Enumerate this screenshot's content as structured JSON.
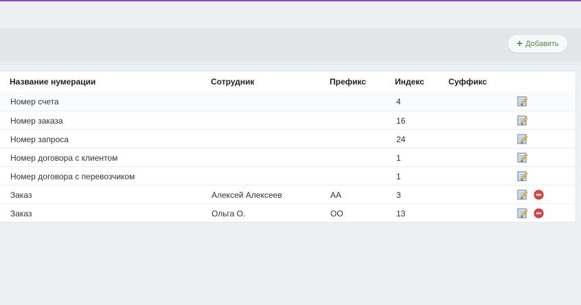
{
  "toolbar": {
    "add_label": "Добавить",
    "add_icon": "plus-icon",
    "accent_color": "#8b46c9"
  },
  "table": {
    "headers": {
      "name": "Название нумерации",
      "employee": "Сотрудник",
      "prefix": "Префикс",
      "index": "Индекс",
      "suffix": "Суффикс"
    },
    "rows": [
      {
        "name": "Номер счета",
        "employee": "",
        "prefix": "",
        "index": "4",
        "suffix": "",
        "deletable": false
      },
      {
        "name": "Номер заказа",
        "employee": "",
        "prefix": "",
        "index": "16",
        "suffix": "",
        "deletable": false
      },
      {
        "name": "Номер запроса",
        "employee": "",
        "prefix": "",
        "index": "24",
        "suffix": "",
        "deletable": false
      },
      {
        "name": "Номер договора с клиентом",
        "employee": "",
        "prefix": "",
        "index": "1",
        "suffix": "",
        "deletable": false
      },
      {
        "name": "Номер договора с перевозчиком",
        "employee": "",
        "prefix": "",
        "index": "1",
        "suffix": "",
        "deletable": false
      },
      {
        "name": "Заказ",
        "employee": "Алексей Алексеев",
        "prefix": "АА",
        "index": "3",
        "suffix": "",
        "deletable": true
      },
      {
        "name": "Заказ",
        "employee": "Ольга О.",
        "prefix": "ОО",
        "index": "13",
        "suffix": "",
        "deletable": true
      }
    ],
    "icons": {
      "edit": "edit-icon",
      "delete": "delete-icon"
    }
  }
}
